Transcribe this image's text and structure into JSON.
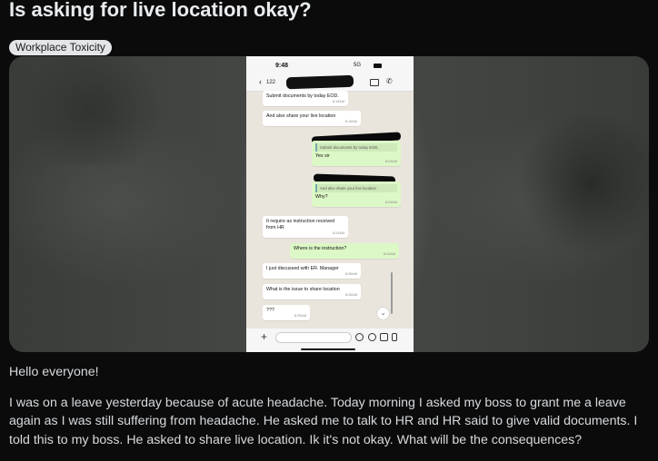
{
  "post": {
    "title": "Is asking for live location okay?",
    "flair": "Workplace Toxicity",
    "body_greeting": "Hello everyone!",
    "body_text": "I was on a leave yesterday because of acute headache. Today morning I asked my boss to grant me a leave again as I was still suffering from headache. He asked me to talk to HR and HR said to give valid documents. I told this to my boss. He asked to share live location. Ik it's not okay. What will be the consequences?"
  },
  "phone": {
    "time": "9:48",
    "signal": "5G",
    "back_count": "122",
    "messages": [
      {
        "from": "in",
        "text": "Submit documents by today EOD.",
        "time": "8:19AM"
      },
      {
        "from": "in",
        "text": "And also share your live location",
        "time": "8:19AM"
      },
      {
        "from": "out",
        "quote": "Submit documents by today EOD.",
        "text": "Yes sir",
        "time": "8:23AM"
      },
      {
        "from": "out",
        "quote": "And also share your live location",
        "text": "Why?",
        "time": "8:23AM"
      },
      {
        "from": "in",
        "text": "It require as instruction received from HR",
        "time": "8:24AM"
      },
      {
        "from": "out",
        "text": "Where is the instruction?",
        "time": "8:24AM"
      },
      {
        "from": "in",
        "text": "I just discussed with ER. Manager",
        "time": "8:25AM"
      },
      {
        "from": "in",
        "text": "What is the issue to share location",
        "time": "8:25AM"
      },
      {
        "from": "in",
        "text": "???",
        "time": "8:25AM"
      }
    ]
  }
}
